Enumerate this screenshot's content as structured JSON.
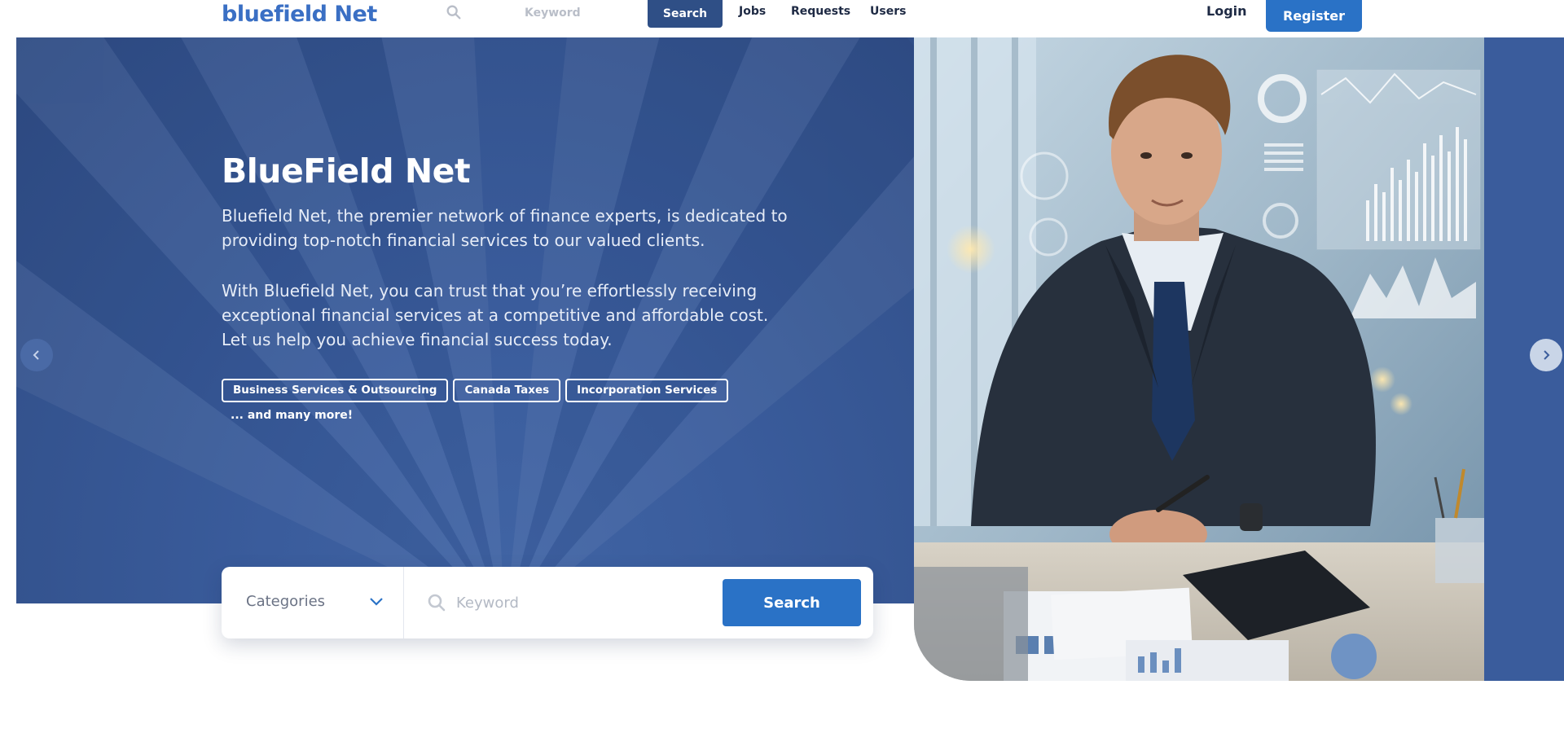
{
  "nav": {
    "logo": "bluefield Net",
    "keyword_placeholder": "Keyword",
    "search_label": "Search",
    "links": [
      "Jobs",
      "Requests",
      "Users"
    ],
    "login_label": "Login",
    "register_label": "Register"
  },
  "hero": {
    "title": "BlueField Net",
    "paragraph1": "Bluefield Net, the premier network of finance experts, is dedicated to providing top-notch financial services to our valued clients.",
    "paragraph2": "With Bluefield Net, you can trust that you’re effortlessly receiving exceptional financial services at a competitive and affordable cost. Let us help you achieve financial success today.",
    "tags": [
      "Business Services & Outsourcing",
      "Canada Taxes",
      "Incorporation Services"
    ],
    "more": "... and many more!"
  },
  "carousel": {
    "prev_icon": "chevron-left-icon",
    "next_icon": "chevron-right-icon"
  },
  "search_card": {
    "category_label": "Categories",
    "keyword_placeholder": "Keyword",
    "search_label": "Search"
  },
  "colors": {
    "brand_blue": "#2a72c6",
    "hero_blue": "#3a5c9c",
    "nav_search": "#2f4f86"
  }
}
